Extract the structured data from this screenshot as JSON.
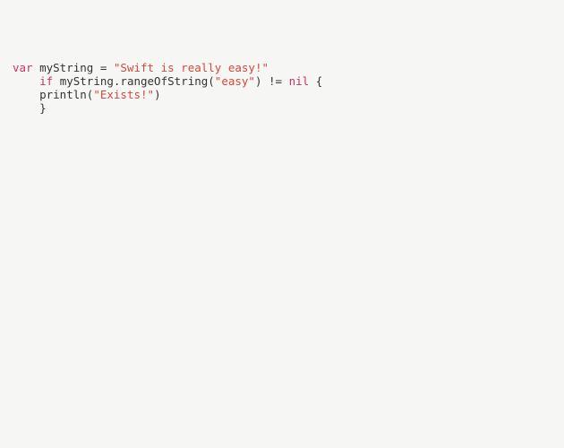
{
  "code": {
    "line1": {
      "kw_var": "var",
      "sp1": " ",
      "ident1": "myString ",
      "eq": "=",
      "sp2": " ",
      "str1": "\"Swift is really easy!\""
    },
    "line2": {
      "indent": "    ",
      "kw_if": "if",
      "sp1": " ",
      "expr1": "myString.rangeOfString(",
      "str1": "\"easy\"",
      "expr2": ") != ",
      "kw_nil": "nil",
      "tail": " {"
    },
    "line3": {
      "indent": "    ",
      "call": "println(",
      "str1": "\"Exists!\"",
      "close": ")"
    },
    "line4": {
      "indent": "    ",
      "brace": "}"
    }
  }
}
